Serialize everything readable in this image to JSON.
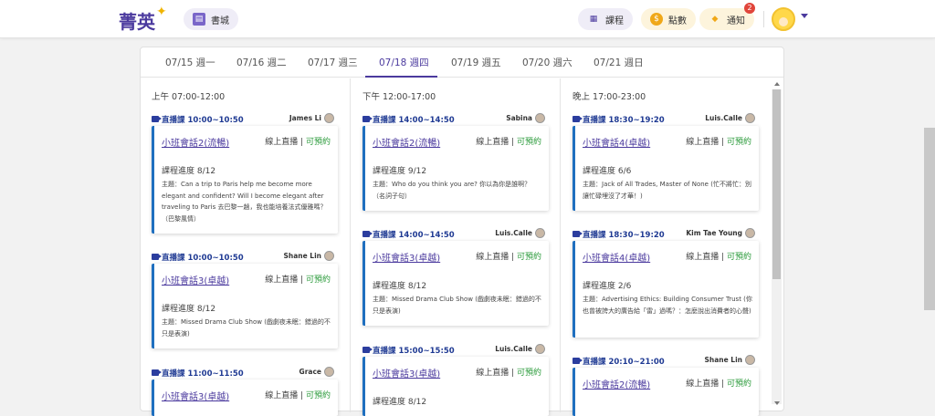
{
  "header": {
    "logo": "菁英",
    "book_label": "書城",
    "course_label": "課程",
    "points_label": "點數",
    "notify_label": "通知",
    "notify_count": "2"
  },
  "tabs": [
    "07/15 週一",
    "07/16 週二",
    "07/17 週三",
    "07/18 週四",
    "07/19 週五",
    "07/20 週六",
    "07/21 週日"
  ],
  "active_tab": "07/18 週四",
  "columns": [
    {
      "title": "上午 07:00-12:00",
      "sessions": [
        {
          "time": "直播課 10:00~10:50",
          "teacher": "James Li",
          "title": "小班會話2(流暢)",
          "status_prefix": "線上直播 | ",
          "status": "可預約",
          "progress": "課程進度 8/12",
          "topic": "主題：Can a trip to Paris help me become more elegant and confident? Will I become elegant after traveling to Paris 去巴黎一趟，我也能培養法式優雅嗎？（巴黎風情）"
        },
        {
          "time": "直播課 10:00~10:50",
          "teacher": "Shane Lin",
          "title": "小班會話3(卓越)",
          "status_prefix": "線上直播 | ",
          "status": "可預約",
          "progress": "課程進度 8/12",
          "topic": "主題：Missed Drama Club Show (戲劇夜未眠：錯過的不只是表演)"
        },
        {
          "time": "直播課 11:00~11:50",
          "teacher": "Grace",
          "title": "小班會話3(卓越)",
          "status_prefix": "線上直播 | ",
          "status": "可預約",
          "progress": "",
          "topic": ""
        }
      ]
    },
    {
      "title": "下午 12:00-17:00",
      "sessions": [
        {
          "time": "直播課 14:00~14:50",
          "teacher": "Sabina",
          "title": "小班會話2(流暢)",
          "status_prefix": "線上直播 | ",
          "status": "可預約",
          "progress": "課程進度 9/12",
          "topic": "主題：Who do you think you are? 你以為你是誰啊？（名詞子句）"
        },
        {
          "time": "直播課 14:00~14:50",
          "teacher": "Luis.Calle",
          "title": "小班會話3(卓越)",
          "status_prefix": "線上直播 | ",
          "status": "可預約",
          "progress": "課程進度 8/12",
          "topic": "主題：Missed Drama Club Show (戲劇夜未眠：錯過的不只是表演)"
        },
        {
          "time": "直播課 15:00~15:50",
          "teacher": "Luis.Calle",
          "title": "小班會話3(卓越)",
          "status_prefix": "線上直播 | ",
          "status": "可預約",
          "progress": "課程進度 8/12",
          "topic": ""
        }
      ]
    },
    {
      "title": "晚上 17:00-23:00",
      "sessions": [
        {
          "time": "直播課 18:30~19:20",
          "teacher": "Luis.Calle",
          "title": "小班會話4(卓越)",
          "status_prefix": "線上直播 | ",
          "status": "可預約",
          "progress": "課程進度 6/6",
          "topic": "主題：Jack of All Trades, Master of None (忙不將忙：別讓忙碌埋沒了才華！)"
        },
        {
          "time": "直播課 18:30~19:20",
          "teacher": "Kim Tae Young",
          "title": "小班會話4(卓越)",
          "status_prefix": "線上直播 | ",
          "status": "可預約",
          "progress": "課程進度 2/6",
          "topic": "主題：Advertising Ethics: Building Consumer Trust (你也曾被誇大的廣告給「雷」過嗎？：怎麼說出消費者的心聲)"
        },
        {
          "time": "直播課 20:10~21:00",
          "teacher": "Shane Lin",
          "title": "小班會話2(流暢)",
          "status_prefix": "線上直播 | ",
          "status": "可預約",
          "progress": "",
          "topic": ""
        }
      ]
    }
  ],
  "colors": {
    "brand": "#4b3a9e",
    "accent_bar": "#1f6fbf",
    "available": "#2a9a3a",
    "session_time": "#1f3a93"
  },
  "icons": [
    "book-icon",
    "calendar-icon",
    "coin-icon",
    "bell-icon",
    "video-camera-icon",
    "sparkle-icon"
  ]
}
